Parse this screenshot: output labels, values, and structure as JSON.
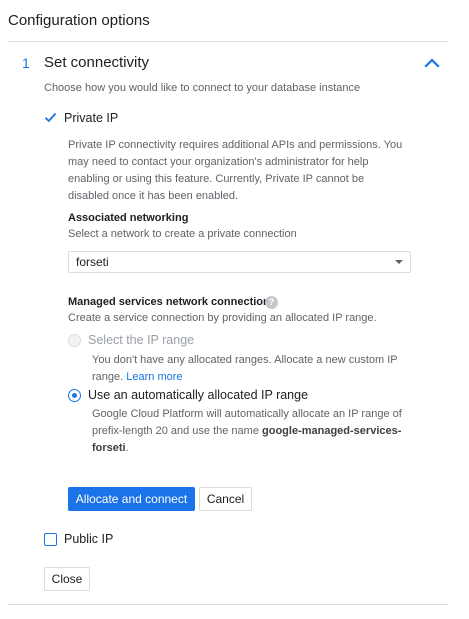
{
  "page": {
    "title": "Configuration options"
  },
  "section": {
    "number": "1",
    "title": "Set connectivity",
    "description": "Choose how you would like to connect to your database instance"
  },
  "private_ip": {
    "label": "Private IP",
    "checked": true,
    "description": "Private IP connectivity requires additional APIs and permissions. You may need to contact your organization's administrator for help enabling or using this feature. Currently, Private IP cannot be disabled once it has been enabled."
  },
  "associated_networking": {
    "heading": "Associated networking",
    "subtext": "Select a network to create a private connection",
    "selected": "forseti"
  },
  "managed_services": {
    "heading": "Managed services network connection",
    "help_icon": "?",
    "subtext": "Create a service connection by providing an allocated IP range.",
    "option_select_range": {
      "label": "Select the IP range",
      "disabled": true,
      "description": "You don't have any allocated ranges. Allocate a new custom IP range.",
      "link": "Learn more"
    },
    "option_auto": {
      "label": "Use an automatically allocated IP range",
      "selected": true,
      "description": "Google Cloud Platform will automatically allocate an IP range of prefix-length 20 and use the name",
      "name": "google-managed-services-forseti",
      "period": "."
    }
  },
  "buttons": {
    "allocate": "Allocate and connect",
    "cancel": "Cancel",
    "close": "Close"
  },
  "public_ip": {
    "label": "Public IP",
    "checked": false
  },
  "colors": {
    "accent": "#1a73e8",
    "divider": "#dadce0",
    "secondary_text": "#5f6368"
  }
}
